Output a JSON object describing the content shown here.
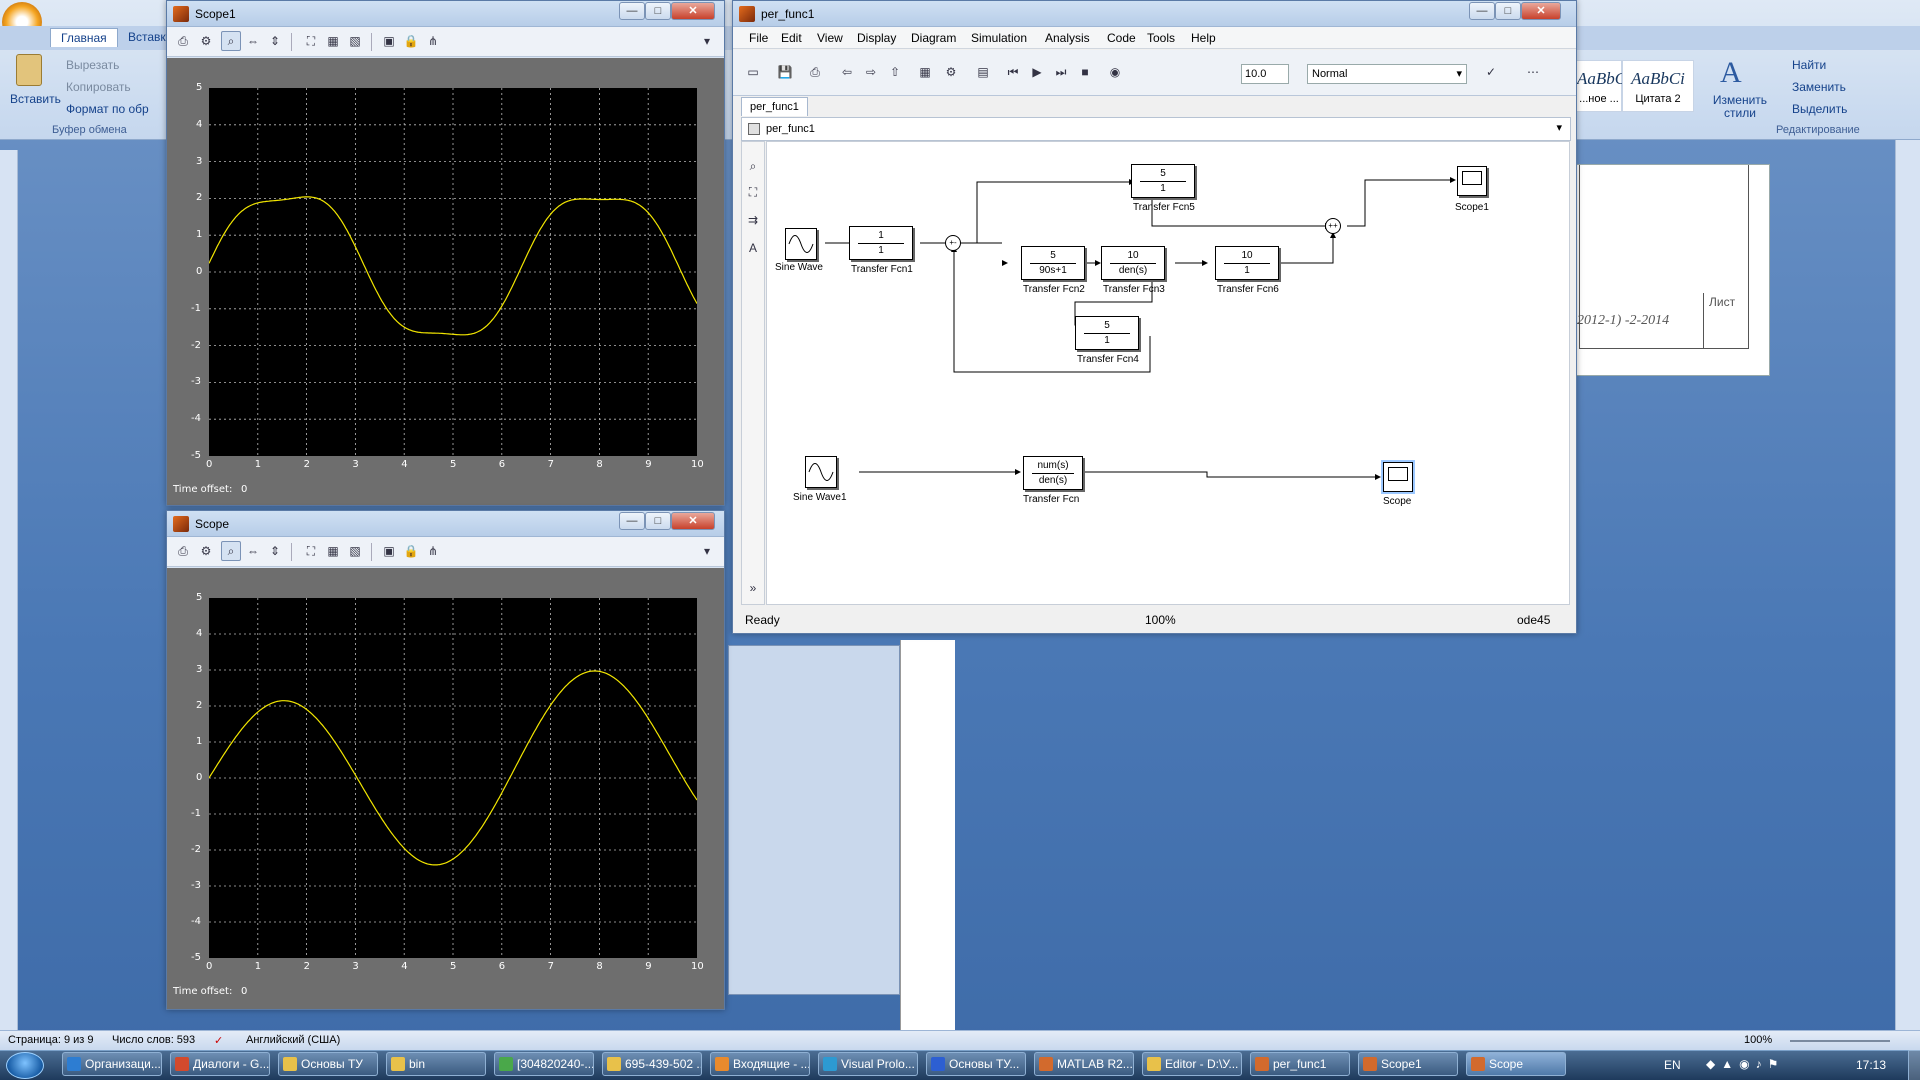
{
  "word": {
    "tabs": [
      "Главная",
      "Вставка"
    ],
    "clipboard": {
      "paste_label": "Вставить",
      "cut_label": "Вырезать",
      "copy_label": "Копировать",
      "format_label": "Формат по обр",
      "group_label": "Буфер обмена"
    },
    "styles": [
      {
        "sample": "AaBbC",
        "name": "...ное ..."
      },
      {
        "sample": "AaBbCi",
        "name": "Цитата 2"
      }
    ],
    "change_styles_label": "Изменить стили",
    "editing": {
      "find_label": "Найти",
      "replace_label": "Заменить",
      "select_label": "Выделить",
      "group_label": "Редактирование"
    },
    "doc_stamp": "2012-1) -2-2014",
    "doc_sheet": "Лист",
    "status": {
      "page": "Страница: 9 из 9",
      "words": "Число слов: 593",
      "lang": "Английский (США)",
      "zoom": "100%"
    }
  },
  "scope1": {
    "title": "Scope1",
    "y_ticks": [
      "5",
      "4",
      "3",
      "2",
      "1",
      "0",
      "-1",
      "-2",
      "-3",
      "-4",
      "-5"
    ],
    "x_ticks": [
      "0",
      "1",
      "2",
      "3",
      "4",
      "5",
      "6",
      "7",
      "8",
      "9",
      "10"
    ],
    "time_offset_label": "Time offset:",
    "time_offset_value": "0"
  },
  "scope": {
    "title": "Scope",
    "y_ticks": [
      "5",
      "4",
      "3",
      "2",
      "1",
      "0",
      "-1",
      "-2",
      "-3",
      "-4",
      "-5"
    ],
    "x_ticks": [
      "0",
      "1",
      "2",
      "3",
      "4",
      "5",
      "6",
      "7",
      "8",
      "9",
      "10"
    ],
    "time_offset_label": "Time offset:",
    "time_offset_value": "0"
  },
  "simulink": {
    "title": "per_func1",
    "menu": [
      "File",
      "Edit",
      "View",
      "Display",
      "Diagram",
      "Simulation",
      "Analysis",
      "Code",
      "Tools",
      "Help"
    ],
    "stop_time": "10.0",
    "sim_mode": "Normal",
    "tab_label": "per_func1",
    "breadcrumb": "per_func1",
    "status": {
      "state": "Ready",
      "zoom": "100%",
      "solver": "ode45"
    },
    "blocks": {
      "sine_wave": "Sine Wave",
      "sine_wave1": "Sine Wave1",
      "tf1": {
        "num": "1",
        "den": "1",
        "label": "Transfer Fcn1"
      },
      "tf2": {
        "num": "5",
        "den": "90s+1",
        "label": "Transfer Fcn2"
      },
      "tf3": {
        "num": "10",
        "den": "den(s)",
        "label": "Transfer Fcn3"
      },
      "tf4": {
        "num": "5",
        "den": "1",
        "label": "Transfer Fcn4"
      },
      "tf5": {
        "num": "5",
        "den": "1",
        "label": "Transfer Fcn5"
      },
      "tf6": {
        "num": "10",
        "den": "1",
        "label": "Transfer Fcn6"
      },
      "tf": {
        "num": "num(s)",
        "den": "den(s)",
        "label": "Transfer Fcn"
      },
      "scope1": "Scope1",
      "scope": "Scope"
    }
  },
  "taskbar": {
    "items": [
      {
        "label": "Организаци...",
        "color": "#2d7dd2"
      },
      {
        "label": "Диалоги - G...",
        "color": "#d24a2d"
      },
      {
        "label": "Основы ТУ",
        "color": "#e8c14a"
      },
      {
        "label": "bin",
        "color": "#e8c14a"
      },
      {
        "label": "[304820240-...",
        "color": "#4aa84a"
      },
      {
        "label": "695-439-502 ...",
        "color": "#e8c14a"
      },
      {
        "label": "Входящие - ...",
        "color": "#e88a2d"
      },
      {
        "label": "Visual Prolo...",
        "color": "#2d9ad2"
      },
      {
        "label": "Основы ТУ...",
        "color": "#2d5fd2"
      },
      {
        "label": "MATLAB R2...",
        "color": "#d26a2d"
      },
      {
        "label": "Editor - D:\\У...",
        "color": "#e8c14a"
      },
      {
        "label": "per_func1",
        "color": "#d26a2d"
      },
      {
        "label": "Scope1",
        "color": "#d26a2d"
      },
      {
        "label": "Scope",
        "color": "#d26a2d"
      }
    ],
    "lang": "EN",
    "time": "17:13"
  }
}
